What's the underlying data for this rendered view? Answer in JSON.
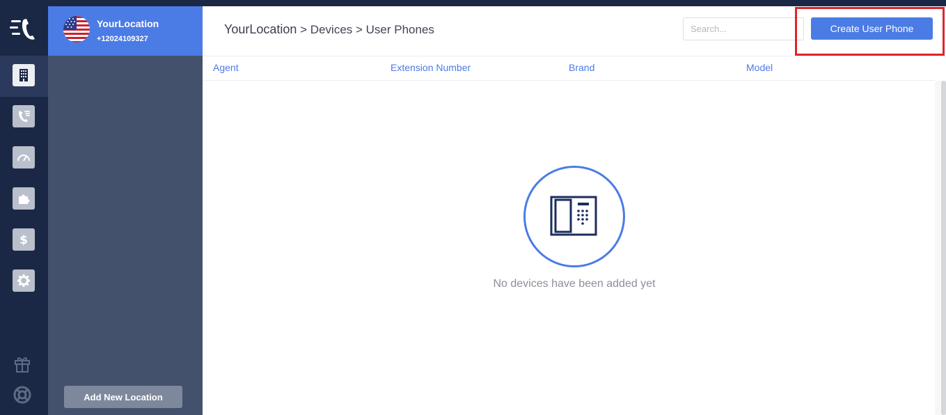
{
  "location": {
    "name": "YourLocation",
    "phone": "+12024109327",
    "add_button": "Add New Location"
  },
  "breadcrumb": {
    "first": "YourLocation",
    "rest": " > Devices > User Phones"
  },
  "search": {
    "placeholder": "Search..."
  },
  "actions": {
    "create_label": "Create User Phone"
  },
  "table": {
    "columns": [
      "Agent",
      "Extension Number",
      "Brand",
      "Model"
    ]
  },
  "empty_state": {
    "message": "No devices have been added yet"
  },
  "colors": {
    "accent": "#4b7be5",
    "rail": "#1b2845",
    "panel": "#44516d",
    "highlight": "#e0242b"
  },
  "rail_icons": [
    "building-icon",
    "call-list-icon",
    "speedometer-icon",
    "puzzle-icon",
    "dollar-icon",
    "gear-icon",
    "gift-icon",
    "support-icon"
  ]
}
